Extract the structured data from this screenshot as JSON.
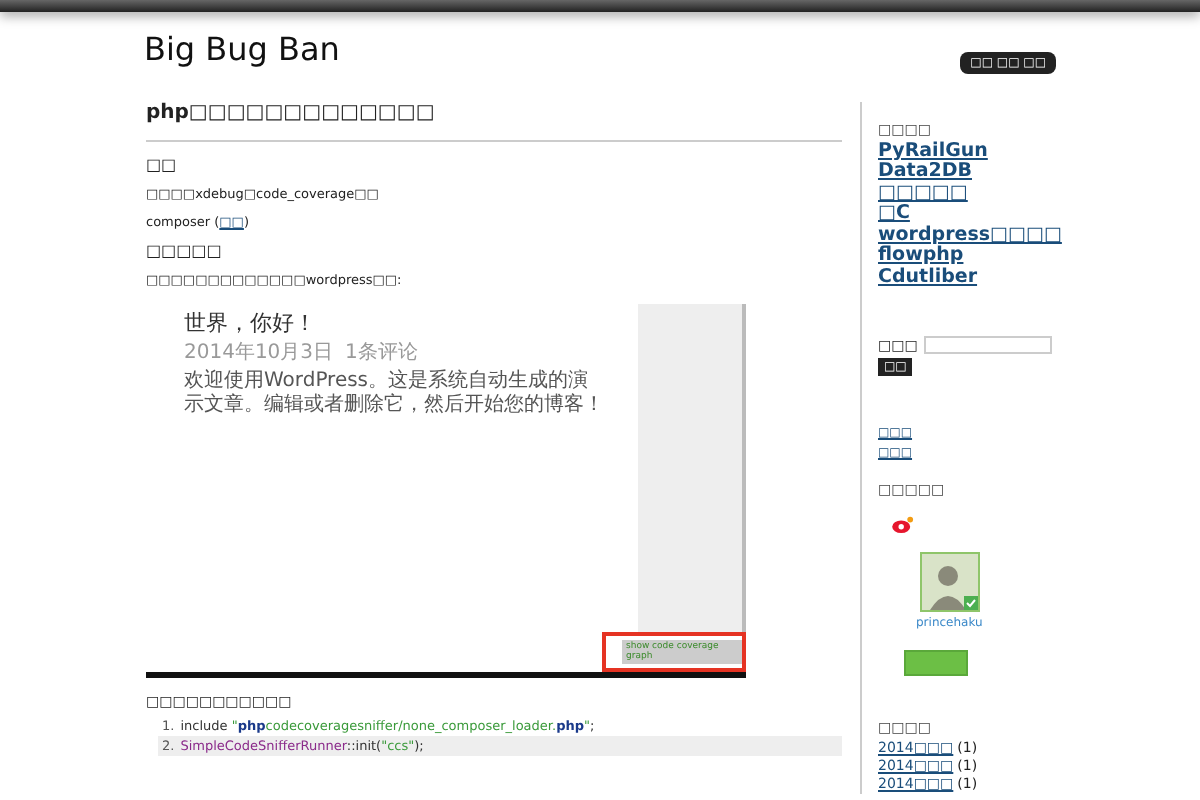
{
  "site": {
    "title": "Big Bug Ban",
    "badge": "□□ □□ □□"
  },
  "post": {
    "title": "php□□□□□□□□□□□□□",
    "sections": [
      {
        "kind": "heading",
        "text": "□□"
      },
      {
        "kind": "para",
        "text": "□□□□xdebug□code_coverage□□"
      },
      {
        "kind": "para-link",
        "text": "composer (",
        "link": "□□",
        "after": ")"
      },
      {
        "kind": "heading",
        "text": "□□□□□"
      },
      {
        "kind": "para",
        "text": "□□□□□□□□□□□□□wordpress□□:"
      }
    ],
    "screenshot": {
      "title": "世界，你好！",
      "date": "2014年10月3日",
      "comments": "1条评论",
      "body": "欢迎使用WordPress。这是系统自动生成的演示文章。编辑或者删除它，然后开始您的博客！",
      "button": "show code coverage graph"
    },
    "code_caption": "□□□□□□□□□□□",
    "code": [
      {
        "number": "1.",
        "highlighted": false,
        "tokens": [
          {
            "kind": "plain",
            "text": "include "
          },
          {
            "kind": "string",
            "text": "\""
          },
          {
            "kind": "bold",
            "text": "php"
          },
          {
            "kind": "string",
            "text": "codecoveragesniffer/none_composer_loader."
          },
          {
            "kind": "bold",
            "text": "php"
          },
          {
            "kind": "string",
            "text": "\""
          },
          {
            "kind": "plain",
            "text": ";"
          }
        ]
      },
      {
        "number": "2.",
        "highlighted": true,
        "tokens": [
          {
            "kind": "class",
            "text": "SimpleCodeSnifferRunner"
          },
          {
            "kind": "plain",
            "text": "::init("
          },
          {
            "kind": "string",
            "text": "\"ccs\""
          },
          {
            "kind": "plain",
            "text": ");"
          }
        ]
      }
    ]
  },
  "sidebar": {
    "links_heading": "□□□□",
    "links": [
      "PyRailGun",
      "Data2DB",
      "□□□□□",
      "□C",
      "wordpress□□□□",
      "flowphp",
      "Cdutliber"
    ],
    "search": {
      "label": "□□□",
      "button": "□□"
    },
    "meta_links": [
      "□□□",
      "□□□"
    ],
    "weibo": {
      "heading": "□□□□□",
      "name": "princehaku"
    },
    "archive": {
      "heading": "□□□□",
      "items": [
        {
          "link": "2014□□□",
          "count": "(1)"
        },
        {
          "link": "2014□□□",
          "count": "(1)"
        },
        {
          "link": "2014□□□",
          "count": "(1)"
        }
      ]
    }
  }
}
